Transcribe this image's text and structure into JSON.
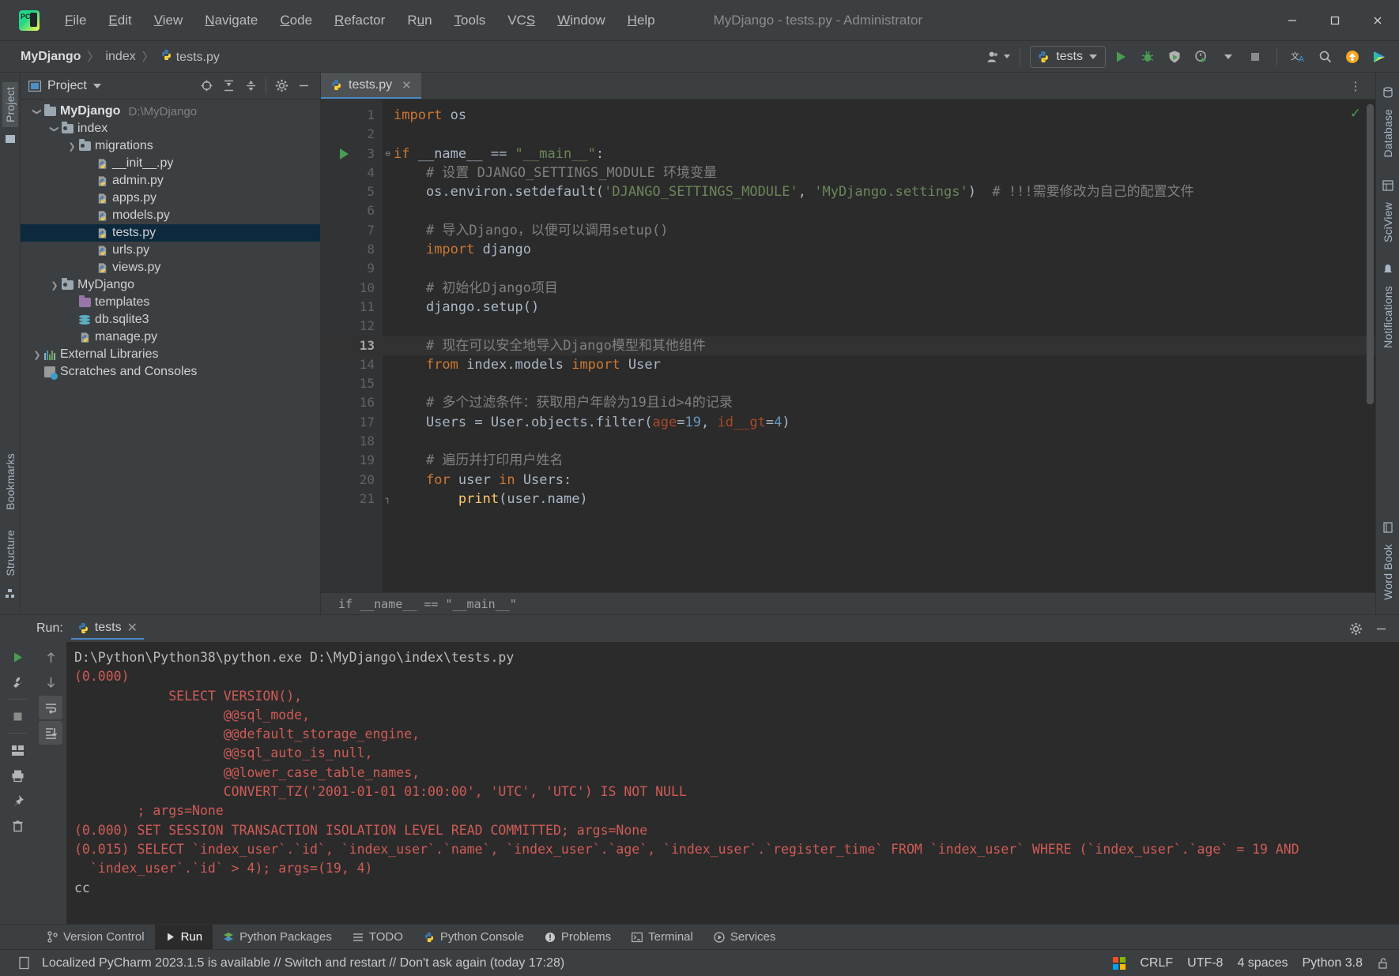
{
  "window": {
    "title": "MyDjango - tests.py - Administrator",
    "app_icon": "pycharm-logo",
    "minimize": "─",
    "maximize": "☐",
    "close": "✕"
  },
  "menu": [
    {
      "label": "File",
      "mnemonic": "F"
    },
    {
      "label": "Edit",
      "mnemonic": "E"
    },
    {
      "label": "View",
      "mnemonic": "V"
    },
    {
      "label": "Navigate",
      "mnemonic": "N"
    },
    {
      "label": "Code",
      "mnemonic": "C"
    },
    {
      "label": "Refactor",
      "mnemonic": "R"
    },
    {
      "label": "Run",
      "mnemonic": "u"
    },
    {
      "label": "Tools",
      "mnemonic": "T"
    },
    {
      "label": "VCS",
      "mnemonic": "S"
    },
    {
      "label": "Window",
      "mnemonic": "W"
    },
    {
      "label": "Help",
      "mnemonic": "H"
    }
  ],
  "breadcrumb": {
    "segments": [
      "MyDjango",
      "index",
      "tests.py"
    ],
    "separator": "〉"
  },
  "toolbar": {
    "user_icon": "user-avatar-icon",
    "run_config": {
      "label": "tests",
      "icon": "python-icon"
    },
    "run_button": "run-icon",
    "debug_button": "debug-icon",
    "coverage_button": "run-with-coverage-icon",
    "profile_button": "profiler-icon",
    "stop_button": "stop-icon",
    "translate_button": "translate-icon",
    "search_button": "search-icon",
    "update_button": "update-icon",
    "plugin_button": "ide-plugin-icon"
  },
  "left_rail": {
    "items": [
      {
        "label": "Project",
        "active": true
      },
      {
        "label": "Bookmarks",
        "active": false
      },
      {
        "label": "Structure",
        "active": false
      }
    ]
  },
  "right_rail": {
    "items": [
      {
        "label": "Database"
      },
      {
        "label": "SciView"
      },
      {
        "label": "Notifications"
      },
      {
        "label": "Word Book"
      }
    ]
  },
  "project_panel": {
    "title": "Project",
    "actions": [
      {
        "name": "select-opened-file-icon",
        "glyph": "⊕"
      },
      {
        "name": "expand-all-icon",
        "glyph": "↧"
      },
      {
        "name": "collapse-all-icon",
        "glyph": "↥"
      },
      {
        "name": "settings-gear-icon",
        "glyph": "⚙"
      },
      {
        "name": "hide-panel-icon",
        "glyph": "─"
      }
    ],
    "tree": [
      {
        "label": "MyDjango",
        "path": "D:\\MyDjango",
        "indent": 0,
        "arrow": "v",
        "icon": "folder",
        "bold": true,
        "selected": false
      },
      {
        "label": "index",
        "path": "",
        "indent": 1,
        "arrow": "v",
        "icon": "folder-src",
        "bold": false,
        "selected": false
      },
      {
        "label": "migrations",
        "path": "",
        "indent": 2,
        "arrow": ">",
        "icon": "folder-src",
        "bold": false,
        "selected": false
      },
      {
        "label": "__init__.py",
        "path": "",
        "indent": 3,
        "arrow": "",
        "icon": "python",
        "bold": false,
        "selected": false
      },
      {
        "label": "admin.py",
        "path": "",
        "indent": 3,
        "arrow": "",
        "icon": "python",
        "bold": false,
        "selected": false
      },
      {
        "label": "apps.py",
        "path": "",
        "indent": 3,
        "arrow": "",
        "icon": "python",
        "bold": false,
        "selected": false
      },
      {
        "label": "models.py",
        "path": "",
        "indent": 3,
        "arrow": "",
        "icon": "python",
        "bold": false,
        "selected": false
      },
      {
        "label": "tests.py",
        "path": "",
        "indent": 3,
        "arrow": "",
        "icon": "python",
        "bold": false,
        "selected": true
      },
      {
        "label": "urls.py",
        "path": "",
        "indent": 3,
        "arrow": "",
        "icon": "python",
        "bold": false,
        "selected": false
      },
      {
        "label": "views.py",
        "path": "",
        "indent": 3,
        "arrow": "",
        "icon": "python",
        "bold": false,
        "selected": false
      },
      {
        "label": "MyDjango",
        "path": "",
        "indent": 1,
        "arrow": ">",
        "icon": "folder-src",
        "bold": false,
        "selected": false
      },
      {
        "label": "templates",
        "path": "",
        "indent": 2,
        "arrow": "",
        "icon": "folder-purple",
        "bold": false,
        "selected": false
      },
      {
        "label": "db.sqlite3",
        "path": "",
        "indent": 2,
        "arrow": "",
        "icon": "database",
        "bold": false,
        "selected": false
      },
      {
        "label": "manage.py",
        "path": "",
        "indent": 2,
        "arrow": "",
        "icon": "python",
        "bold": false,
        "selected": false
      },
      {
        "label": "External Libraries",
        "path": "",
        "indent": 0,
        "arrow": ">",
        "icon": "library",
        "bold": false,
        "selected": false
      },
      {
        "label": "Scratches and Consoles",
        "path": "",
        "indent": 0,
        "arrow": "",
        "icon": "scratch",
        "bold": false,
        "selected": false
      }
    ]
  },
  "editor": {
    "tab": {
      "label": "tests.py",
      "icon": "python-icon",
      "close": "✕"
    },
    "more_icon": "⋮",
    "inspection_ok": "✓",
    "current_line": 13,
    "run_marker_line": 3,
    "breadcrumb_bottom": "if __name__ == \"__main__\"",
    "lines": [
      {
        "n": 1,
        "tokens": [
          {
            "t": "import",
            "c": "kw"
          },
          {
            "t": " os",
            "c": "txt"
          }
        ]
      },
      {
        "n": 2,
        "tokens": []
      },
      {
        "n": 3,
        "tokens": [
          {
            "t": "if",
            "c": "kw"
          },
          {
            "t": " __name__ == ",
            "c": "txt"
          },
          {
            "t": "\"__main__\"",
            "c": "str"
          },
          {
            "t": ":",
            "c": "txt"
          }
        ]
      },
      {
        "n": 4,
        "tokens": [
          {
            "t": "    # 设置 DJANGO_SETTINGS_MODULE 环境变量",
            "c": "cmt"
          }
        ]
      },
      {
        "n": 5,
        "tokens": [
          {
            "t": "    os.environ.setdefault(",
            "c": "txt"
          },
          {
            "t": "'DJANGO_SETTINGS_MODULE'",
            "c": "str"
          },
          {
            "t": ", ",
            "c": "txt"
          },
          {
            "t": "'MyDjango.settings'",
            "c": "str"
          },
          {
            "t": ")  ",
            "c": "txt"
          },
          {
            "t": "# !!!需要修改为自己的配置文件",
            "c": "cmt"
          }
        ]
      },
      {
        "n": 6,
        "tokens": []
      },
      {
        "n": 7,
        "tokens": [
          {
            "t": "    # 导入Django，以便可以调用setup()",
            "c": "cmt"
          }
        ]
      },
      {
        "n": 8,
        "tokens": [
          {
            "t": "    ",
            "c": "txt"
          },
          {
            "t": "import",
            "c": "kw"
          },
          {
            "t": " django",
            "c": "txt"
          }
        ]
      },
      {
        "n": 9,
        "tokens": []
      },
      {
        "n": 10,
        "tokens": [
          {
            "t": "    # 初始化Django项目",
            "c": "cmt"
          }
        ]
      },
      {
        "n": 11,
        "tokens": [
          {
            "t": "    django.setup()",
            "c": "txt"
          }
        ]
      },
      {
        "n": 12,
        "tokens": []
      },
      {
        "n": 13,
        "tokens": [
          {
            "t": "    # 现在可以安全地导入Django模型和其他组件",
            "c": "cmt"
          }
        ]
      },
      {
        "n": 14,
        "tokens": [
          {
            "t": "    ",
            "c": "txt"
          },
          {
            "t": "from",
            "c": "kw"
          },
          {
            "t": " index.models ",
            "c": "txt"
          },
          {
            "t": "import",
            "c": "kw"
          },
          {
            "t": " User",
            "c": "txt"
          }
        ]
      },
      {
        "n": 15,
        "tokens": []
      },
      {
        "n": 16,
        "tokens": [
          {
            "t": "    # 多个过滤条件：获取用户年龄为19且id>4的记录",
            "c": "cmt"
          }
        ]
      },
      {
        "n": 17,
        "tokens": [
          {
            "t": "    Users = User.objects.filter(",
            "c": "txt"
          },
          {
            "t": "age",
            "c": "kwarg"
          },
          {
            "t": "=",
            "c": "txt"
          },
          {
            "t": "19",
            "c": "num"
          },
          {
            "t": ", ",
            "c": "txt"
          },
          {
            "t": "id__gt",
            "c": "kwarg"
          },
          {
            "t": "=",
            "c": "txt"
          },
          {
            "t": "4",
            "c": "num"
          },
          {
            "t": ")",
            "c": "txt"
          }
        ]
      },
      {
        "n": 18,
        "tokens": []
      },
      {
        "n": 19,
        "tokens": [
          {
            "t": "    # 遍历并打印用户姓名",
            "c": "cmt"
          }
        ]
      },
      {
        "n": 20,
        "tokens": [
          {
            "t": "    ",
            "c": "txt"
          },
          {
            "t": "for",
            "c": "kw"
          },
          {
            "t": " user ",
            "c": "txt"
          },
          {
            "t": "in",
            "c": "kw"
          },
          {
            "t": " Users:",
            "c": "txt"
          }
        ]
      },
      {
        "n": 21,
        "tokens": [
          {
            "t": "        ",
            "c": "txt"
          },
          {
            "t": "print",
            "c": "fn"
          },
          {
            "t": "(user.name)",
            "c": "txt"
          }
        ]
      }
    ]
  },
  "run_panel": {
    "label": "Run:",
    "tab": {
      "label": "tests",
      "icon": "python-icon",
      "close": "✕"
    },
    "header_actions": [
      {
        "name": "settings-gear-icon",
        "glyph": "⚙"
      },
      {
        "name": "hide-panel-icon",
        "glyph": "─"
      }
    ],
    "side_actions": [
      {
        "name": "rerun-icon",
        "glyph": "▶"
      },
      {
        "name": "wrench-icon",
        "glyph": "ὒ7"
      },
      {
        "name": "stop-icon",
        "glyph": "■"
      },
      {
        "name": "print-icon",
        "glyph": "⎙"
      },
      {
        "name": "pin-icon",
        "glyph": "✒"
      },
      {
        "name": "trash-icon",
        "glyph": "Ὕ1"
      }
    ],
    "nav_actions": [
      {
        "name": "up-arrow-icon",
        "glyph": "↑"
      },
      {
        "name": "down-arrow-icon",
        "glyph": "↓"
      },
      {
        "name": "soft-wrap-icon",
        "glyph": "↵"
      },
      {
        "name": "scroll-to-end-icon",
        "glyph": "⇩"
      }
    ],
    "console_lines": [
      {
        "color": "white",
        "text": "D:\\Python\\Python38\\python.exe D:\\MyDjango\\index\\tests.py"
      },
      {
        "color": "red",
        "text": "(0.000)"
      },
      {
        "color": "red",
        "text": "            SELECT VERSION(),"
      },
      {
        "color": "red",
        "text": "                   @@sql_mode,"
      },
      {
        "color": "red",
        "text": "                   @@default_storage_engine,"
      },
      {
        "color": "red",
        "text": "                   @@sql_auto_is_null,"
      },
      {
        "color": "red",
        "text": "                   @@lower_case_table_names,"
      },
      {
        "color": "red",
        "text": "                   CONVERT_TZ('2001-01-01 01:00:00', 'UTC', 'UTC') IS NOT NULL"
      },
      {
        "color": "red",
        "text": "        ; args=None"
      },
      {
        "color": "red",
        "text": "(0.000) SET SESSION TRANSACTION ISOLATION LEVEL READ COMMITTED; args=None"
      },
      {
        "color": "red",
        "text": "(0.015) SELECT `index_user`.`id`, `index_user`.`name`, `index_user`.`age`, `index_user`.`register_time` FROM `index_user` WHERE (`index_user`.`age` = 19 AND"
      },
      {
        "color": "red",
        "text": "  `index_user`.`id` > 4); args=(19, 4)"
      },
      {
        "color": "white",
        "text": "cc"
      }
    ]
  },
  "bottom_tabs": [
    {
      "label": "Version Control",
      "icon": "branch-icon",
      "active": false
    },
    {
      "label": "Run",
      "icon": "run-icon",
      "active": true
    },
    {
      "label": "Python Packages",
      "icon": "packages-icon",
      "active": false
    },
    {
      "label": "TODO",
      "icon": "todo-icon",
      "active": false
    },
    {
      "label": "Python Console",
      "icon": "python-icon",
      "active": false
    },
    {
      "label": "Problems",
      "icon": "problems-icon",
      "active": false
    },
    {
      "label": "Terminal",
      "icon": "terminal-icon",
      "active": false
    },
    {
      "label": "Services",
      "icon": "services-icon",
      "active": false
    }
  ],
  "status_bar": {
    "left_icon": "event-log-icon",
    "notification": "Localized PyCharm 2023.1.5 is available // Switch and restart // Don't ask again (today 17:28)",
    "os_icon": "windows-logo",
    "line_separator": "CRLF",
    "encoding": "UTF-8",
    "indent": "4 spaces",
    "interpreter": "Python 3.8",
    "lock_icon": "unlocked-icon"
  },
  "colors": {
    "bg_panel": "#3c3f41",
    "bg_editor": "#2b2b2b",
    "accent_blue": "#4a88c7",
    "selection": "#0d293e",
    "green": "#499c54",
    "keyword": "#cc7832",
    "string": "#6a8759",
    "comment": "#808080",
    "number": "#6897bb",
    "console_red": "#cf5b56",
    "text": "#a9b7c6"
  }
}
